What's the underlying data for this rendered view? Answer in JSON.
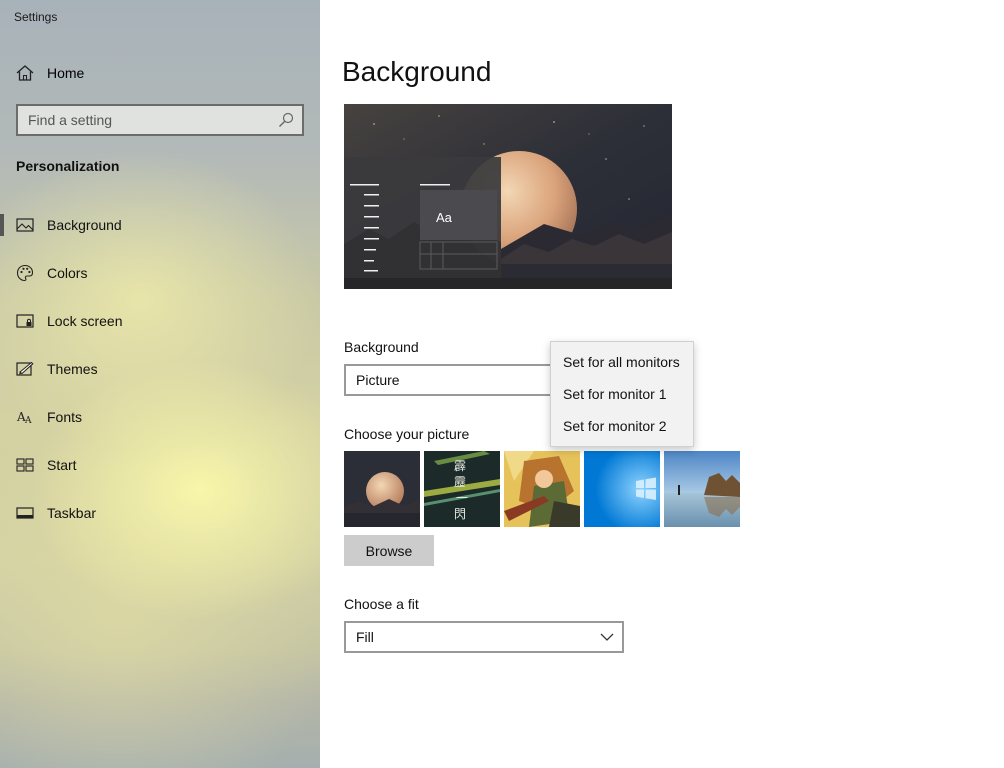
{
  "window": {
    "title": "Settings"
  },
  "sidebar": {
    "home_label": "Home",
    "search": {
      "placeholder": "Find a setting"
    },
    "section_title": "Personalization",
    "items": [
      {
        "label": "Background",
        "icon": "picture-icon",
        "selected": true
      },
      {
        "label": "Colors",
        "icon": "palette-icon",
        "selected": false
      },
      {
        "label": "Lock screen",
        "icon": "lock-screen-icon",
        "selected": false
      },
      {
        "label": "Themes",
        "icon": "themes-icon",
        "selected": false
      },
      {
        "label": "Fonts",
        "icon": "fonts-icon",
        "selected": false
      },
      {
        "label": "Start",
        "icon": "start-icon",
        "selected": false
      },
      {
        "label": "Taskbar",
        "icon": "taskbar-icon",
        "selected": false
      }
    ]
  },
  "main": {
    "title": "Background",
    "preview": {
      "sample_text": "Aa"
    },
    "background_label": "Background",
    "background_value": "Picture",
    "choose_picture_label": "Choose your picture",
    "pictures": [
      {
        "name": "moon-landscape"
      },
      {
        "name": "anime-calligraphy",
        "text": [
          "霹",
          "靂",
          "一",
          "閃"
        ]
      },
      {
        "name": "anime-warrior"
      },
      {
        "name": "windows-blue"
      },
      {
        "name": "beach-rocks"
      }
    ],
    "browse_label": "Browse",
    "fit_label": "Choose a fit",
    "fit_value": "Fill"
  },
  "context_menu": {
    "items": [
      "Set for all monitors",
      "Set for monitor 1",
      "Set for monitor 2"
    ]
  },
  "colors": {
    "selection_indicator": "#555555",
    "button_bg": "#cccccc",
    "menu_bg": "#f2f2f2"
  }
}
